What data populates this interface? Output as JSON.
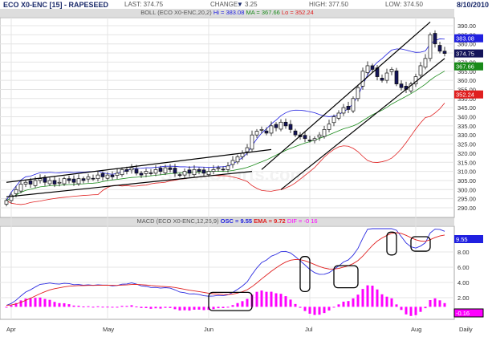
{
  "header": {
    "title": "ECO X0-ENC [15] - RAPESEED",
    "last": "LAST: 374.75",
    "change_label": "CHANGE:",
    "change_arrow": "▼",
    "change": "3.25",
    "high": "HIGH: 377.50",
    "low": "LOW: 374.50",
    "date": "8/10/2010"
  },
  "boll": {
    "label": "BOLL (ECO X0-ENC,20,2)",
    "hi": "Hi = 383.08",
    "ma": "MA = 367.66",
    "lo": "Lo = 352.24"
  },
  "macd": {
    "label": "MACD (ECO X0-ENC,12,26,9)",
    "osc": "OSC = 9.55",
    "ema": "EMA = 9.72",
    "dif": "DIF = -0.16"
  },
  "colors": {
    "up": "#ffffff",
    "down": "#14145a",
    "hi": "#2020e0",
    "ma": "#1a8a1a",
    "lo": "#e02020",
    "macd": "#2a2ae0",
    "signal": "#e02020",
    "hist": "#ff00ff"
  },
  "chart_data": [
    {
      "type": "candlestick",
      "title": "ECO X0-ENC [15] - RAPESEED",
      "ylim": [
        287,
        393
      ],
      "yticks": [
        390,
        385,
        380,
        375,
        370,
        365,
        360,
        355,
        350,
        345,
        340,
        335,
        330,
        325,
        320,
        315,
        310,
        305,
        300,
        295,
        290
      ],
      "xticks": [
        {
          "label": "Apr",
          "index": 1
        },
        {
          "label": "May",
          "index": 21
        },
        {
          "label": "Jun",
          "index": 42
        },
        {
          "label": "Jul",
          "index": 63
        },
        {
          "label": "Aug",
          "index": 85
        }
      ],
      "xaxis_label": "Daily",
      "closes": [
        294,
        297,
        300,
        303,
        304,
        303,
        305,
        306,
        304,
        305,
        303,
        304,
        306,
        305,
        304,
        306,
        305,
        307,
        306,
        308,
        307,
        308,
        307,
        309,
        311,
        310,
        312,
        309,
        308,
        310,
        309,
        311,
        310,
        312,
        311,
        309,
        308,
        310,
        309,
        311,
        310,
        309,
        310,
        311,
        312,
        311,
        313,
        316,
        318,
        320,
        323,
        330,
        332,
        333,
        331,
        335,
        334,
        337,
        335,
        333,
        330,
        329,
        328,
        327,
        328,
        330,
        333,
        336,
        340,
        342,
        345,
        344,
        350,
        356,
        365,
        368,
        366,
        362,
        360,
        364,
        366,
        358,
        356,
        355,
        358,
        362,
        368,
        372,
        385,
        380,
        376,
        374.75
      ],
      "tags": [
        {
          "value": "383.08",
          "price": 383.08,
          "color": "#2020e0"
        },
        {
          "value": "374.75",
          "price": 374.75,
          "color": "#14145a"
        },
        {
          "value": "367.66",
          "price": 367.66,
          "color": "#1a8a1a"
        },
        {
          "value": "352.24",
          "price": 352.24,
          "color": "#e02020"
        }
      ],
      "trendlines": [
        [
          0,
          304,
          55,
          322
        ],
        [
          0,
          296,
          51,
          310
        ],
        [
          53,
          311,
          88,
          392
        ],
        [
          57,
          300,
          91,
          372
        ]
      ]
    },
    {
      "type": "line",
      "title": "MACD (ECO X0-ENC,12,26,9)",
      "ylim": [
        -1.5,
        11
      ],
      "yticks": [
        "8.00",
        "6.00",
        "4.00",
        "2.00"
      ],
      "tags": [
        {
          "value": "9.55",
          "color": "#2020e0"
        },
        {
          "value": "-0.16",
          "color": "#ff00ff"
        }
      ],
      "boxes": [
        [
          42,
          51,
          0.3,
          2.7
        ],
        [
          61,
          63,
          2.8,
          7.4
        ],
        [
          68,
          73,
          3.3,
          6.2
        ],
        [
          79,
          81,
          7.6,
          10.6
        ],
        [
          84,
          88,
          8.1,
          10
        ]
      ]
    }
  ]
}
